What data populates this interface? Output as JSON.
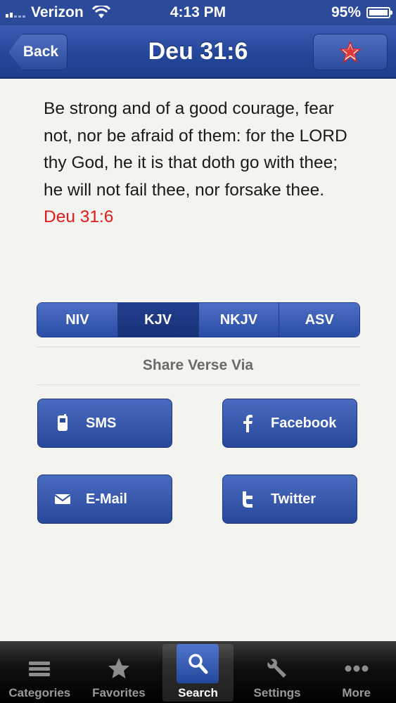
{
  "status_bar": {
    "carrier": "Verizon",
    "time": "4:13 PM",
    "battery": "95%"
  },
  "nav": {
    "back_label": "Back",
    "title": "Deu 31:6",
    "favorite_icon": "star-icon"
  },
  "verse": {
    "text": " Be strong and of a good courage, fear not, nor be afraid of them: for the LORD thy God, he it is that doth go with thee; he will not fail thee, nor forsake thee. ",
    "reference": "Deu 31:6",
    "reference_color": "#e11b1b"
  },
  "translations": {
    "items": [
      "NIV",
      "KJV",
      "NKJV",
      "ASV"
    ],
    "selected": "KJV"
  },
  "share": {
    "title": "Share Verse Via",
    "buttons": [
      {
        "label": "SMS",
        "icon": "phone-icon"
      },
      {
        "label": "Facebook",
        "icon": "facebook-icon"
      },
      {
        "label": "E-Mail",
        "icon": "mail-icon"
      },
      {
        "label": "Twitter",
        "icon": "twitter-icon"
      }
    ]
  },
  "tab_bar": {
    "tabs": [
      {
        "label": "Categories",
        "icon": "list-icon"
      },
      {
        "label": "Favorites",
        "icon": "star-icon"
      },
      {
        "label": "Search",
        "icon": "search-icon"
      },
      {
        "label": "Settings",
        "icon": "wrench-icon"
      },
      {
        "label": "More",
        "icon": "more-icon"
      }
    ],
    "selected": "Search"
  },
  "colors": {
    "nav_blue": "#24479a",
    "accent_red": "#e11b1b"
  }
}
